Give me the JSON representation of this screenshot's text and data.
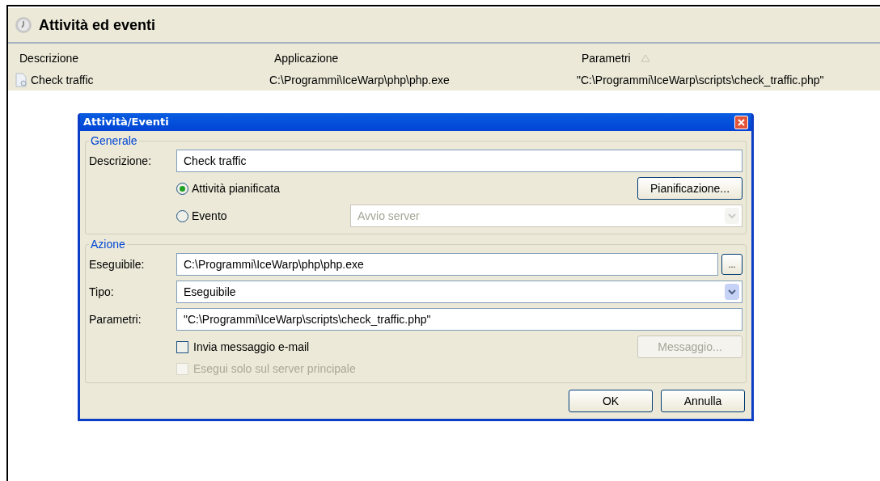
{
  "panel": {
    "title": "Attività ed eventi",
    "columns": [
      {
        "label": "Descrizione",
        "sorted": false
      },
      {
        "label": "Applicazione",
        "sorted": false
      },
      {
        "label": "Parametri",
        "sorted": true
      }
    ],
    "rows": [
      {
        "cells": [
          "Check traffic",
          "C:\\Programmi\\IceWarp\\php\\php.exe",
          "\"C:\\Programmi\\IceWarp\\scripts\\check_traffic.php\""
        ],
        "selected": true
      }
    ]
  },
  "dialog": {
    "title": "Attività/Eventi",
    "general": {
      "legend": "Generale",
      "description_label": "Descrizione:",
      "description_value": "Check traffic",
      "radios": [
        {
          "label": "Attività pianificata",
          "selected": true
        },
        {
          "label": "Evento",
          "selected": false
        }
      ],
      "schedule_button": "Pianificazione...",
      "event_select": {
        "value": "Avvio server",
        "disabled": true
      }
    },
    "action": {
      "legend": "Azione",
      "executable_label": "Eseguibile:",
      "executable_value": "C:\\Programmi\\IceWarp\\php\\php.exe",
      "browse_button": "...",
      "type_label": "Tipo:",
      "type_value": "Eseguibile",
      "params_label": "Parametri:",
      "params_value": "\"C:\\Programmi\\IceWarp\\scripts\\check_traffic.php\"",
      "checkboxes": [
        {
          "label": "Invia messaggio e-mail",
          "checked": false,
          "disabled": false
        },
        {
          "label": "Esegui solo sul server principale",
          "checked": false,
          "disabled": true
        }
      ],
      "message_button": {
        "label": "Messaggio...",
        "disabled": true
      }
    },
    "buttons": [
      "OK",
      "Annulla"
    ]
  }
}
